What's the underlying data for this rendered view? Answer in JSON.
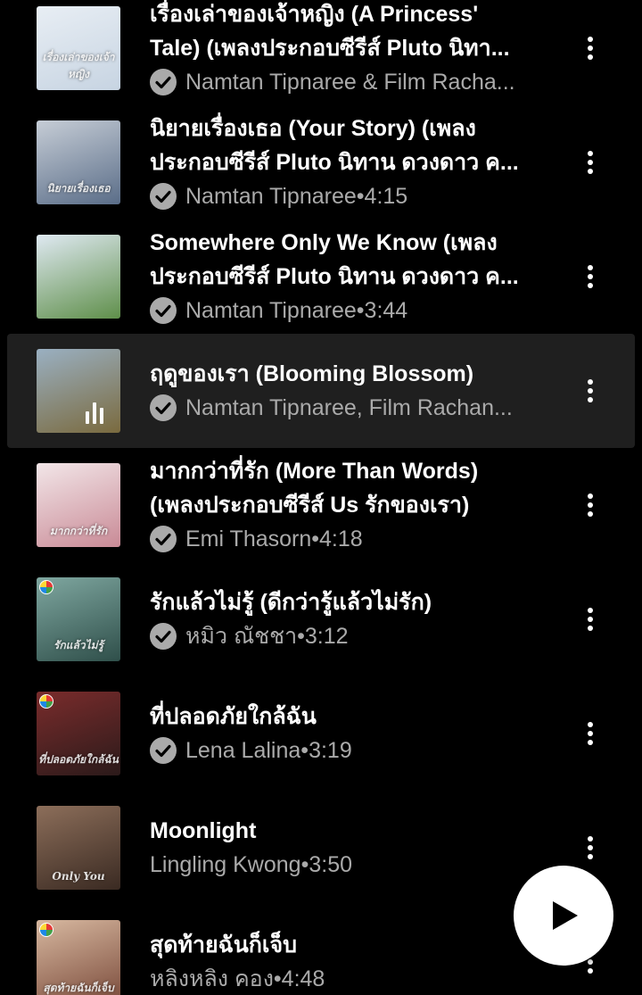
{
  "songs": [
    {
      "title_line1": "เรื่องเล่าของเจ้าหญิง (A Princess'",
      "title_line2": "Tale) (เพลงประกอบซีรีส์ Pluto นิทา...",
      "artist": "Namtan Tipnaree & Film Racha...",
      "duration": "",
      "verified": true,
      "thumb_caption": "เรื่องเล่าของเจ้าหญิง",
      "thumb_colors": [
        "#e8eef4",
        "#c7d4e2"
      ]
    },
    {
      "title_line1": "นิยายเรื่องเธอ (Your Story) (เพลง",
      "title_line2": "ประกอบซีรีส์ Pluto นิทาน ดวงดาว ค...",
      "artist": "Namtan Tipnaree",
      "duration": "4:15",
      "verified": true,
      "thumb_caption": "นิยายเรื่องเธอ",
      "thumb_colors": [
        "#c6cdd6",
        "#5a6d88"
      ]
    },
    {
      "title_line1": "Somewhere Only We Know (เพลง",
      "title_line2": "ประกอบซีรีส์ Pluto นิทาน ดวงดาว ค...",
      "artist": "Namtan Tipnaree",
      "duration": "3:44",
      "verified": true,
      "thumb_caption": "",
      "thumb_colors": [
        "#dfe9f2",
        "#5f8f4a"
      ]
    },
    {
      "title_line1": "ฤดูของเรา (Blooming Blossom)",
      "title_line2": "",
      "artist": "Namtan Tipnaree, Film Rachan...",
      "duration": "",
      "verified": true,
      "playing": true,
      "thumb_caption": "",
      "thumb_colors": [
        "#9ab0c2",
        "#7a6a3e"
      ]
    },
    {
      "title_line1": "มากกว่าที่รัก (More Than Words)",
      "title_line2": "(เพลงประกอบซีรีส์ Us รักของเรา)",
      "artist": "Emi Thasorn",
      "duration": "4:18",
      "verified": true,
      "thumb_caption": "มากกว่าที่รัก",
      "thumb_colors": [
        "#f2e6e8",
        "#c98a96"
      ]
    },
    {
      "title_line1": "รักแล้วไม่รู้ (ดีกว่ารู้แล้วไม่รัก)",
      "title_line2": "",
      "artist": "หมิว ณัชชา",
      "duration": "3:12",
      "verified": true,
      "badge": true,
      "thumb_caption": "รักแล้วไม่รู้",
      "thumb_colors": [
        "#7fa7a0",
        "#2f4f4a"
      ]
    },
    {
      "title_line1": "ที่ปลอดภัยใกล้ฉัน",
      "title_line2": "",
      "artist": "Lena Lalina",
      "duration": "3:19",
      "verified": true,
      "badge": true,
      "thumb_caption": "ที่ปลอดภัยใกล้ฉัน",
      "thumb_colors": [
        "#7a2c2c",
        "#2b1a1a"
      ]
    },
    {
      "title_line1": "Moonlight",
      "title_line2": "",
      "artist": "Lingling Kwong",
      "duration": "3:50",
      "verified": false,
      "thumb_caption": "Only You",
      "thumb_colors": [
        "#8c6e5a",
        "#3a2a22"
      ]
    },
    {
      "title_line1": "สุดท้ายฉันก็เจ็บ",
      "title_line2": "",
      "artist": "หลิงหลิง คอง",
      "duration": "4:48",
      "verified": false,
      "badge": true,
      "thumb_caption": "สุดท้ายฉันก็เจ็บ",
      "thumb_colors": [
        "#d7b8a0",
        "#7a4a3a"
      ]
    }
  ],
  "separator": " • ",
  "icons": {
    "verified": "check-circle-icon",
    "more": "more-vert-icon",
    "play": "play-icon",
    "now_playing": "equalizer-icon"
  }
}
